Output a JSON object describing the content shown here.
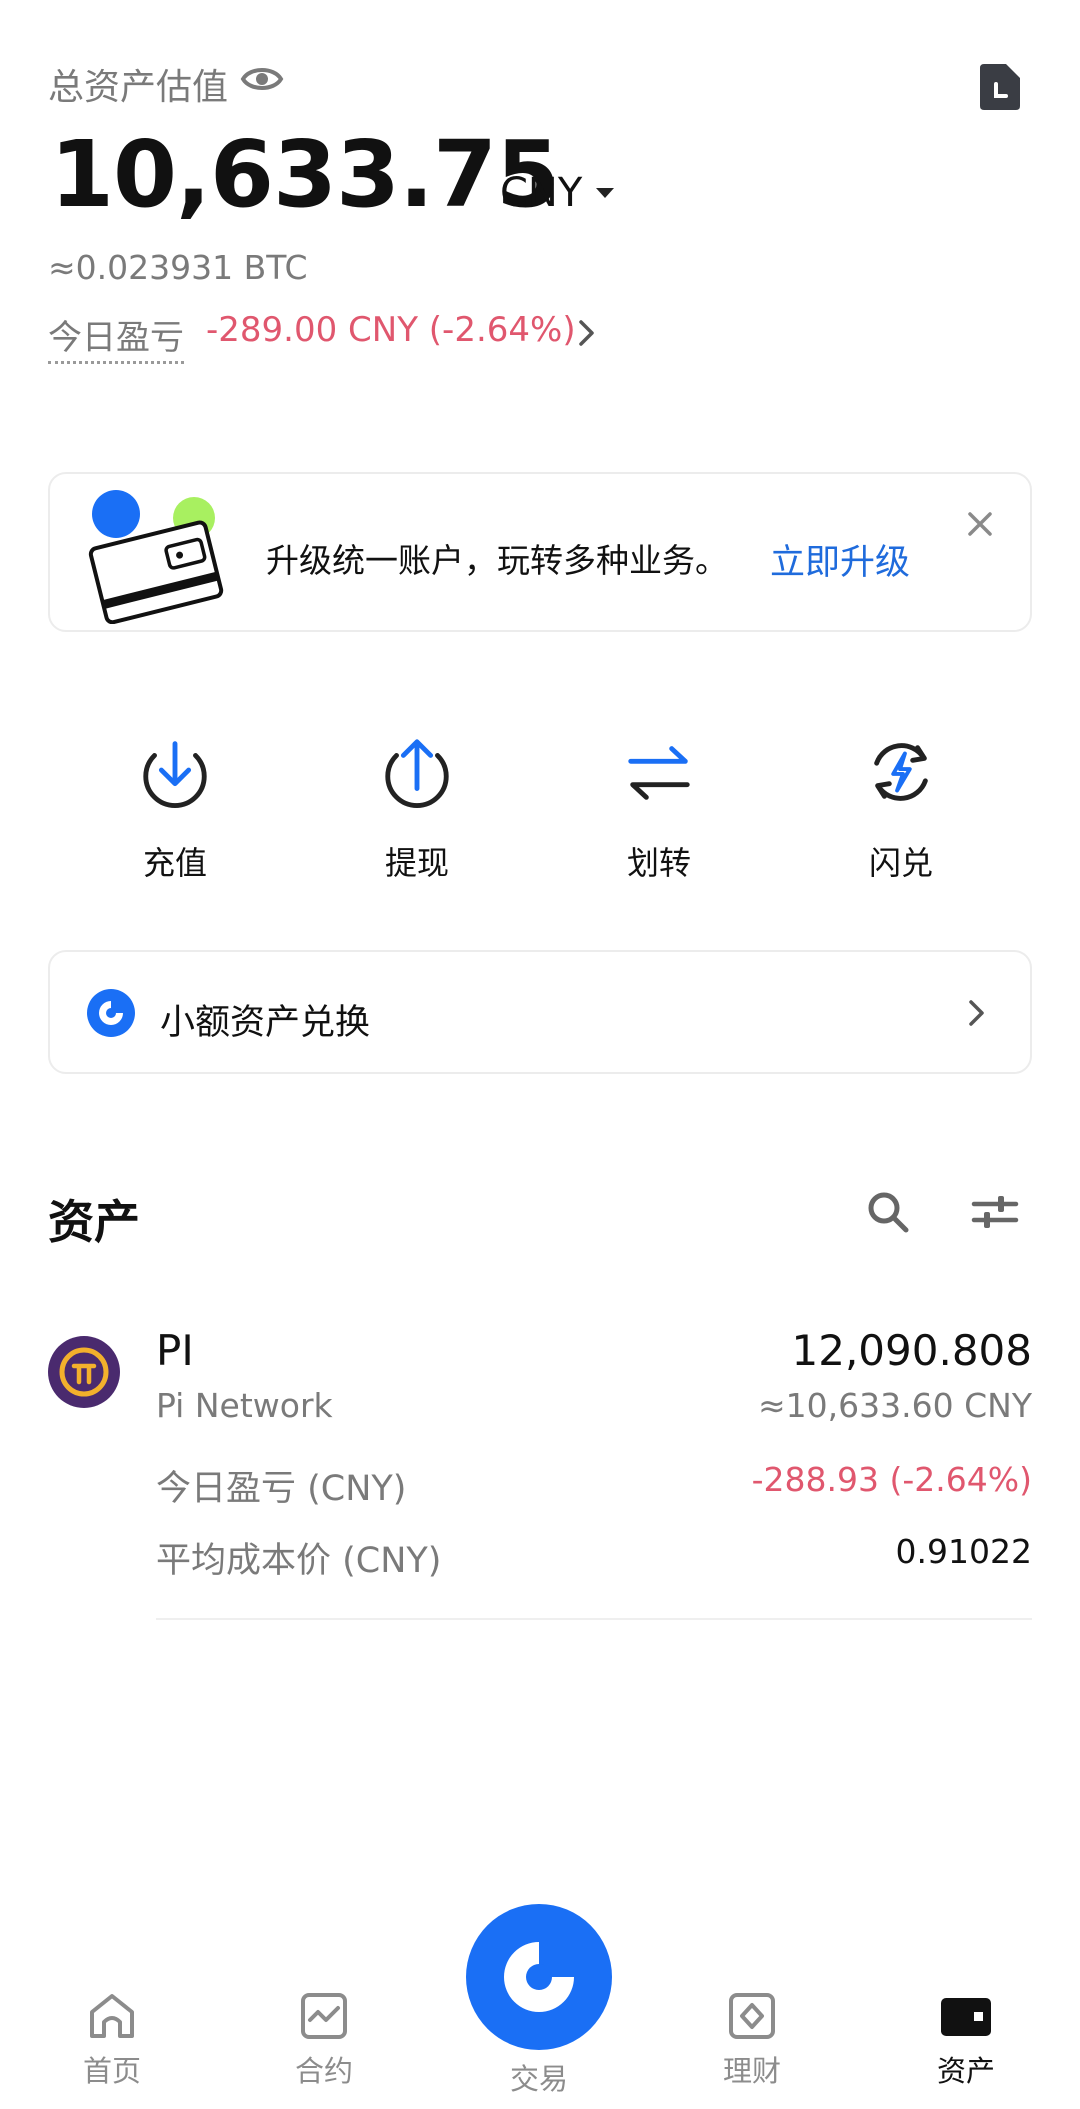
{
  "header": {
    "total_label": "总资产估值",
    "total_value": "10,633.75",
    "currency": "CNY",
    "btc_value": "≈0.023931 BTC",
    "pnl_label": "今日盈亏",
    "pnl_value": "-289.00 CNY (-2.64%)"
  },
  "banner": {
    "text": "升级统一账户，玩转多种业务。",
    "link": "立即升级"
  },
  "actions": [
    {
      "label": "充值",
      "icon": "deposit-icon"
    },
    {
      "label": "提现",
      "icon": "withdraw-icon"
    },
    {
      "label": "划转",
      "icon": "transfer-icon"
    },
    {
      "label": "闪兑",
      "icon": "flash-exchange-icon"
    }
  ],
  "small_exchange": {
    "label": "小额资产兑换"
  },
  "assets": {
    "title": "资产",
    "items": [
      {
        "symbol": "PI",
        "name": "Pi Network",
        "amount": "12,090.808",
        "value": "≈10,633.60 CNY",
        "pnl_label": "今日盈亏 (CNY)",
        "pnl_value": "-288.93 (-2.64%)",
        "cost_label": "平均成本价 (CNY)",
        "cost_value": "0.91022"
      }
    ]
  },
  "nav": {
    "items": [
      {
        "label": "首页",
        "icon": "home-icon"
      },
      {
        "label": "合约",
        "icon": "futures-icon"
      },
      {
        "label": "交易",
        "icon": "trade-icon"
      },
      {
        "label": "理财",
        "icon": "earn-icon"
      },
      {
        "label": "资产",
        "icon": "assets-icon",
        "active": true
      }
    ]
  },
  "colors": {
    "accent": "#1a6ff5",
    "link": "#1f6bdc",
    "negative": "#e0576e",
    "muted": "#7a7a7a"
  }
}
